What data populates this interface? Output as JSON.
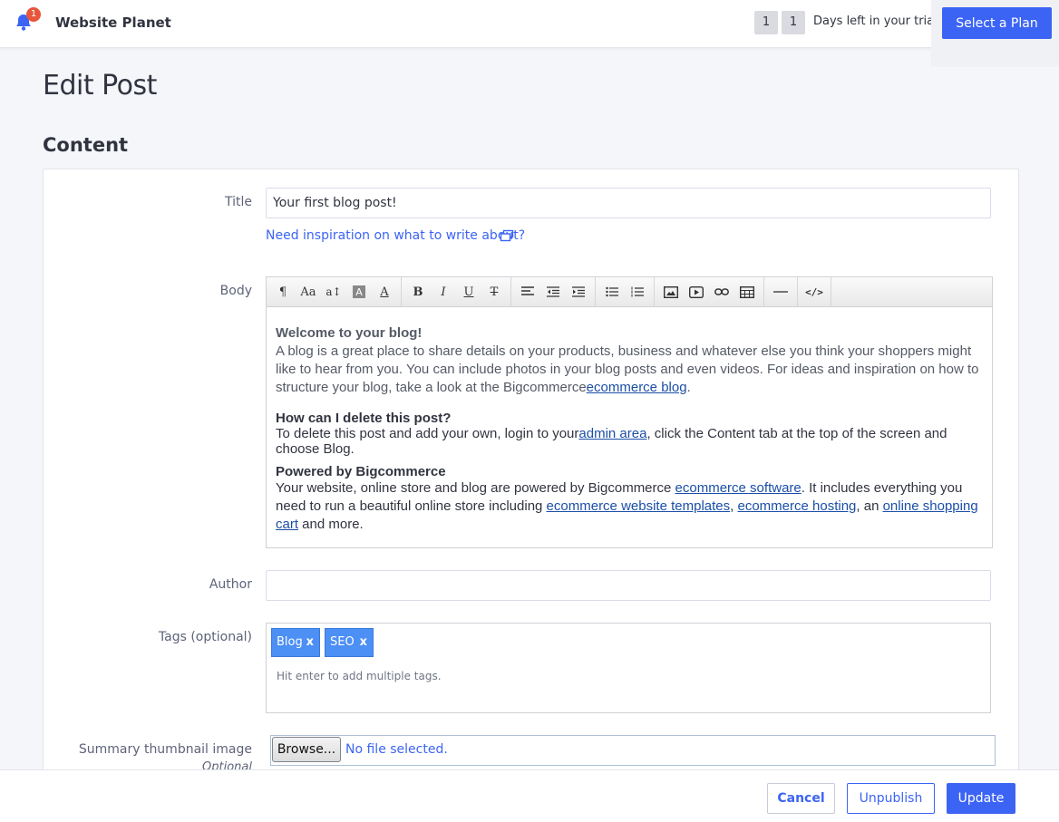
{
  "header": {
    "store_name": "Website Planet",
    "notification_count": "1",
    "trial_days_1": "1",
    "trial_days_2": "1",
    "trial_text": "Days left in your trial.",
    "select_plan_label": "Select a Plan"
  },
  "page": {
    "title": "Edit Post",
    "section_title": "Content"
  },
  "form": {
    "title_label": "Title",
    "title_value": "Your first blog post!",
    "inspiration_link": "Need inspiration on what to write about?",
    "body_label": "Body",
    "author_label": "Author",
    "author_value": "",
    "tags_label": "Tags (optional)",
    "tags": [
      "Blog",
      "SEO"
    ],
    "tag_remove": "x",
    "tags_hint": "Hit enter to add multiple tags.",
    "thumbnail_label": "Summary thumbnail image",
    "thumbnail_sub": "Optional",
    "browse_label": "Browse...",
    "file_status": "No file selected."
  },
  "editor": {
    "toolbar_icons": [
      "paragraph-icon",
      "font-family-icon",
      "font-size-icon",
      "background-color-icon",
      "text-color-icon",
      "bold-icon",
      "italic-icon",
      "underline-icon",
      "strikethrough-icon",
      "align-icon",
      "outdent-icon",
      "indent-icon",
      "bullet-list-icon",
      "ordered-list-icon",
      "image-icon",
      "video-icon",
      "link-icon",
      "table-icon",
      "horizontal-rule-icon",
      "code-view-icon"
    ],
    "p1_heading": "Welcome to your blog!",
    "p1_text": "A blog is a great place to share details on your products, business and whatever else you think your shoppers might like to hear from you. You can include photos in your blog posts and even videos. For ideas and inspiration on how to structure your blog, take a look at the Bigcommerce",
    "p1_link": "ecommerce blog",
    "p1_end": ".",
    "p2_heading": "How can I delete this post?",
    "p2_text_a": "To delete this post and add your own, login to your",
    "p2_link": "admin area",
    "p2_text_b": ", click the Content tab at the top of the screen and choose Blog.",
    "p3_heading": "Powered by Bigcommerce",
    "p3_text_a": "Your website, online store and blog are powered by Bigcommerce ",
    "p3_link_1": "ecommerce software",
    "p3_text_b": ". It includes everything you need to run a beautiful online store including ",
    "p3_link_2": "ecommerce website templates",
    "p3_text_c": ", ",
    "p3_link_3": "ecommerce hosting",
    "p3_text_d": ", an ",
    "p3_link_4": "online shopping cart",
    "p3_text_e": " and more."
  },
  "footer": {
    "cancel_label": "Cancel",
    "unpublish_label": "Unpublish",
    "update_label": "Update"
  },
  "colors": {
    "primary": "#3c64f4",
    "badge": "#e7563b",
    "tag": "#4c8ff5"
  }
}
